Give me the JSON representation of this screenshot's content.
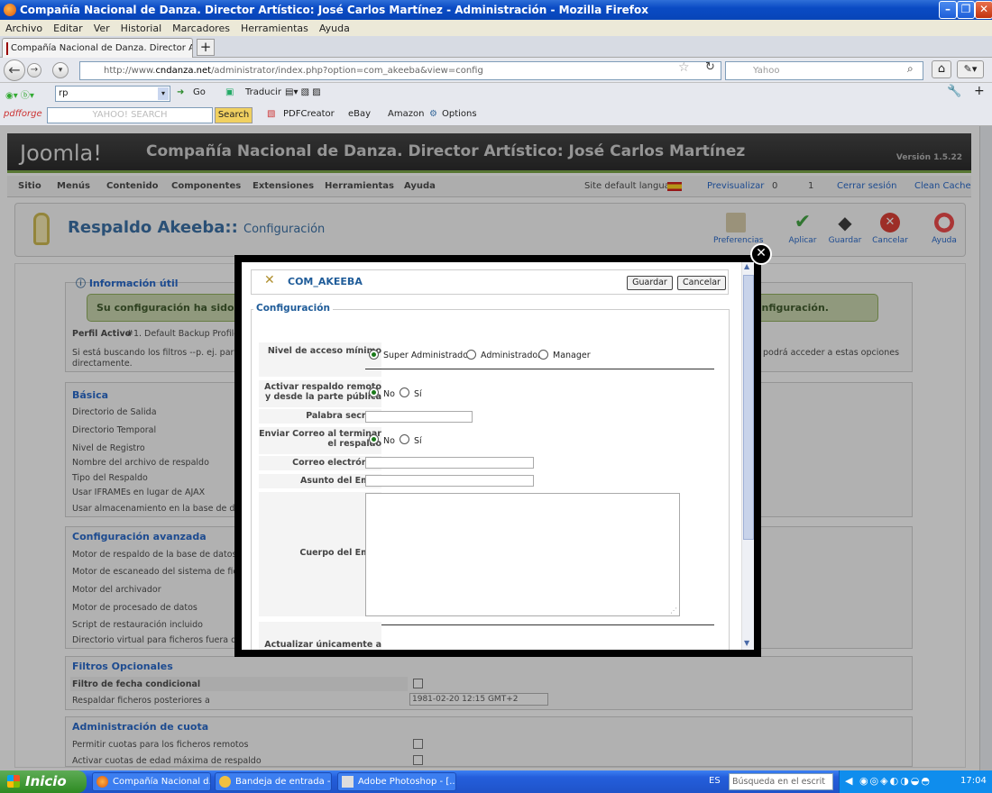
{
  "window": {
    "title": "Compañía Nacional de Danza. Director Artístico: José Carlos Martínez - Administración - Mozilla Firefox"
  },
  "menu": [
    "Archivo",
    "Editar",
    "Ver",
    "Historial",
    "Marcadores",
    "Herramientas",
    "Ayuda"
  ],
  "tab": {
    "label": "Compañía Nacional de Danza. Director Artísti..."
  },
  "url": {
    "prefix": "http://www.",
    "domain": "cndanza.net",
    "path": "/administrator/index.php?option=com_akeeba&view=config"
  },
  "search": {
    "placeholder": "Yahoo"
  },
  "toolbar2": {
    "field": "rp",
    "go": "Go",
    "translate": "Traducir"
  },
  "toolbar3": {
    "brand": "pdfforge",
    "yahoo": "YAHOO! SEARCH",
    "search_btn": "Search",
    "pdf": "PDFCreator",
    "ebay": "eBay",
    "amazon": "Amazon",
    "options": "Options"
  },
  "joomla": {
    "logo": "Joomla!",
    "site": "Compañía Nacional de Danza. Director Artístico: José Carlos Martínez",
    "version": "Versión 1.5.22",
    "menu": [
      "Sitio",
      "Menús",
      "Contenido",
      "Componentes",
      "Extensiones",
      "Herramientas",
      "Ayuda"
    ],
    "status": {
      "lang": "Site default language",
      "preview": "Previsualizar",
      "count0": "0",
      "count1": "1",
      "logout": "Cerrar sesión",
      "cache": "Clean Cache"
    },
    "title": "Respaldo Akeeba::",
    "subtitle": "Configuración",
    "actions": [
      "Preferencias",
      "Aplicar",
      "Guardar",
      "Cancelar",
      "Ayuda"
    ]
  },
  "background": {
    "info_title": "Información útil",
    "success_left": "Su configuración ha sido",
    "success_right": "onfiguración.",
    "profile_label": "Perfil Activo",
    "profile_value": "#1. Default Backup Profile",
    "note_left": "Si está buscando los filtros --p. ej. para exc",
    "note_line2": "directamente.",
    "note_right": "podrá acceder a estas opciones",
    "basic": {
      "title": "Básica",
      "rows": [
        "Directorio de Salida",
        "Directorio Temporal",
        "Nivel de Registro",
        "Nombre del archivo de respaldo",
        "Tipo del Respaldo",
        "Usar IFRAMEs en lugar de AJAX",
        "Usar almacenamiento en la base de datos p"
      ]
    },
    "advanced": {
      "title": "Configuración avanzada",
      "rows": [
        "Motor de respaldo de la base de datos",
        "Motor de escaneado del sistema de ficheros",
        "Motor del archivador",
        "Motor de procesado de datos",
        "Script de restauración incluido",
        "Directorio virtual para ficheros fuera del sit"
      ]
    },
    "optional": {
      "title": "Filtros Opcionales",
      "rows": [
        "Filtro de fecha condicional",
        "Respaldar ficheros posteriores a"
      ],
      "date": "1981-02-20 12:15 GMT+2"
    },
    "quota": {
      "title": "Administración de cuota",
      "rows": [
        "Permitir cuotas para los ficheros remotos",
        "Activar cuotas de edad máxima de respaldo"
      ]
    }
  },
  "modal": {
    "component": "COM_AKEEBA",
    "save": "Guardar",
    "cancel": "Cancelar",
    "legend": "Configuración",
    "access_label": "Nivel de acceso mínimo",
    "access_options": [
      "Super Administrador",
      "Administrador",
      "Manager"
    ],
    "remote_label": "Activar respaldo remoto y desde la parte pública",
    "secret_label": "Palabra secreta",
    "mail_label": "Enviar Correo al terminar el respaldo",
    "no": "No",
    "yes": "Sí",
    "email_label": "Correo electrónico",
    "subject_label": "Asunto del Email",
    "body_label": "Cuerpo del Email",
    "update_label": "Actualizar únicamente a"
  },
  "taskbar": {
    "start": "Inicio",
    "tasks": [
      "Compañía Nacional d...",
      "Bandeja de entrada -...",
      "Adobe Photoshop - [..."
    ],
    "lang": "ES",
    "search_placeholder": "Búsqueda en el escrit",
    "clock": "17:04"
  }
}
